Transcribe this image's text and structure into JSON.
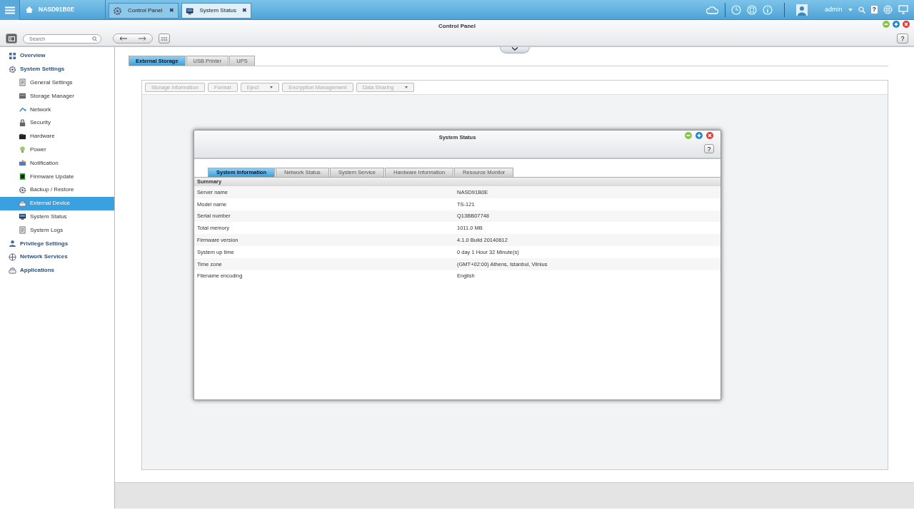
{
  "top_bar": {
    "home_label": "NASD91B0E",
    "tabs": [
      {
        "label": "Control Panel",
        "kind": "gear",
        "selected": false,
        "close": "✖"
      },
      {
        "label": "System Status",
        "kind": "monitor",
        "selected": true,
        "close": "✖"
      }
    ],
    "user": "admin",
    "help": "?"
  },
  "window": {
    "title": "Control Panel",
    "help": "?",
    "search": {
      "placeholder": "Search"
    }
  },
  "sidebar": {
    "items": [
      {
        "label": "Overview",
        "kind": "grid",
        "selected": false
      },
      {
        "label": "System Settings",
        "kind": "gear",
        "selected": false,
        "children": [
          {
            "label": "General Settings",
            "kind": "doc",
            "selected": false
          },
          {
            "label": "Storage Manager",
            "kind": "disk",
            "selected": false
          },
          {
            "label": "Network",
            "kind": "net",
            "selected": false
          },
          {
            "label": "Security",
            "kind": "lock",
            "selected": false
          },
          {
            "label": "Hardware",
            "kind": "box",
            "selected": false
          },
          {
            "label": "Power",
            "kind": "bulb",
            "selected": false
          },
          {
            "label": "Notification",
            "kind": "mail",
            "selected": false
          },
          {
            "label": "Firmware Update",
            "kind": "chip",
            "selected": false
          },
          {
            "label": "Backup / Restore",
            "kind": "gear",
            "selected": false
          },
          {
            "label": "External Device",
            "kind": "drive",
            "selected": true
          },
          {
            "label": "System Status",
            "kind": "monitor",
            "selected": false
          },
          {
            "label": "System Logs",
            "kind": "doc",
            "selected": false
          }
        ]
      },
      {
        "label": "Privilege Settings",
        "kind": "user",
        "selected": false
      },
      {
        "label": "Network Services",
        "kind": "globe",
        "selected": false
      },
      {
        "label": "Applications",
        "kind": "drive",
        "selected": false
      }
    ]
  },
  "content": {
    "tabs": [
      {
        "label": "External Storage",
        "selected": true
      },
      {
        "label": "USB Printer",
        "selected": false
      },
      {
        "label": "UPS",
        "selected": false
      }
    ],
    "toolbar": [
      {
        "label": "Storage Information",
        "dropdown": false,
        "disabled": true
      },
      {
        "label": "Format",
        "dropdown": false,
        "disabled": true
      },
      {
        "label": "Eject",
        "dropdown": true,
        "disabled": true
      },
      {
        "label": "Encryption Management",
        "dropdown": false,
        "disabled": true
      },
      {
        "label": "Data Sharing",
        "dropdown": true,
        "disabled": true
      }
    ]
  },
  "dialog": {
    "title": "System Status",
    "help": "?",
    "tabs": [
      {
        "label": "System Information",
        "selected": true
      },
      {
        "label": "Network Status",
        "selected": false
      },
      {
        "label": "System Service",
        "selected": false
      },
      {
        "label": "Hardware Information",
        "selected": false
      },
      {
        "label": "Resource Monitor",
        "selected": false
      }
    ],
    "section": "Summary",
    "rows": [
      {
        "label": "Server name",
        "value": "NASD91B0E"
      },
      {
        "label": "Model name",
        "value": "TS-121"
      },
      {
        "label": "Serial number",
        "value": "Q13BB07748"
      },
      {
        "label": "Total memory",
        "value": "1011.0 MB"
      },
      {
        "label": "Firmware version",
        "value": "4.1.0 Build 20140612"
      },
      {
        "label": "System up time",
        "value": "0 day 1 Hour 32 Minute(s)"
      },
      {
        "label": "Time zone",
        "value": "(GMT+02:00) Athens, Istanbul, Vilnius"
      },
      {
        "label": "Filename encoding",
        "value": "English"
      }
    ]
  }
}
